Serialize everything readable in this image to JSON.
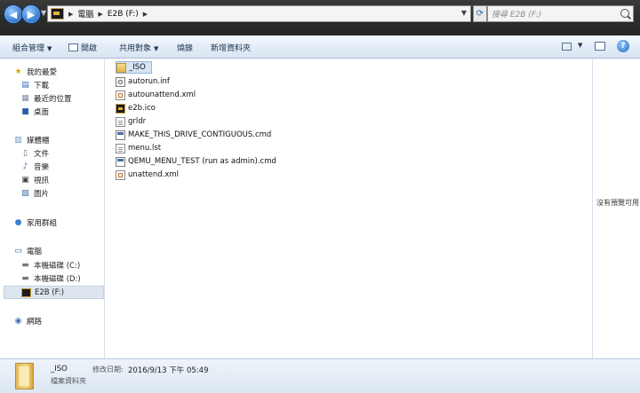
{
  "address": {
    "crumbs": [
      "電腦",
      "E2B (F:)"
    ],
    "search_placeholder": "搜尋 E2B (F:)"
  },
  "toolbar": {
    "organize": "組合管理",
    "open": "開啟",
    "share": "共用對象",
    "burn": "燒錄",
    "new_folder": "新增資料夾"
  },
  "nav": {
    "favorites": "我的最愛",
    "downloads": "下載",
    "recent": "最近的位置",
    "desktop": "桌面",
    "libraries": "媒體櫃",
    "documents": "文件",
    "music": "音樂",
    "videos": "視訊",
    "pictures": "圖片",
    "homegroup": "家用群組",
    "computer": "電腦",
    "drive_c": "本機磁碟 (C:)",
    "drive_d": "本機磁碟 (D:)",
    "drive_f": "E2B (F:)",
    "network": "網路"
  },
  "files": [
    {
      "name": "_ISO",
      "icon": "folder-icon"
    },
    {
      "name": "autorun.inf",
      "icon": "gear-file-icon"
    },
    {
      "name": "autounattend.xml",
      "icon": "xml-file-icon"
    },
    {
      "name": "e2b.ico",
      "icon": "e2b-file-icon"
    },
    {
      "name": "grldr",
      "icon": "file-icon"
    },
    {
      "name": "MAKE_THIS_DRIVE_CONTIGUOUS.cmd",
      "icon": "cmd-file-icon"
    },
    {
      "name": "menu.lst",
      "icon": "file-icon"
    },
    {
      "name": "QEMU_MENU_TEST (run as admin).cmd",
      "icon": "cmd-file-icon"
    },
    {
      "name": "unattend.xml",
      "icon": "xml-file-icon"
    }
  ],
  "preview": {
    "message": "沒有預覽可用"
  },
  "details": {
    "name": "_ISO",
    "type": "檔案資料夾",
    "modified_label": "修改日期:",
    "modified_value": "2016/9/13 下午 05:49"
  },
  "colors": {
    "titlebar": "#2b2b2b",
    "toolbar": "#e4edf7",
    "selection": "#d7e4f3",
    "accent": "#3e85d6"
  }
}
